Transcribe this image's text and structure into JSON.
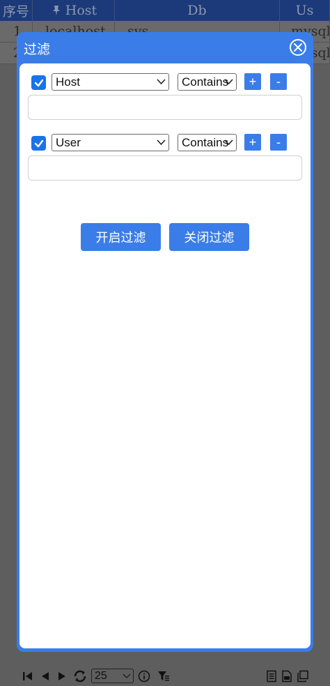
{
  "table": {
    "headers": [
      "序号",
      "Host",
      "Db",
      "Us"
    ],
    "rows": [
      [
        "1",
        "localhost",
        "sys",
        "mysql"
      ],
      [
        "2",
        "",
        "",
        "mysql"
      ]
    ]
  },
  "dialog": {
    "title": "过滤",
    "filters": [
      {
        "checked": true,
        "field": "Host",
        "operator": "Contains",
        "value": "",
        "add_label": "+",
        "remove_label": "-"
      },
      {
        "checked": true,
        "field": "User",
        "operator": "Contains",
        "value": "",
        "add_label": "+",
        "remove_label": "-"
      }
    ],
    "open_filter_label": "开启过滤",
    "close_filter_label": "关闭过滤"
  },
  "pager": {
    "page_size": "25",
    "icons": [
      "first-page-icon",
      "prev-page-icon",
      "next-page-icon",
      "refresh-icon",
      "info-icon",
      "filter-icon",
      "document-icon",
      "export-icon",
      "copy-icon"
    ]
  },
  "colors": {
    "accent": "#3a7de8",
    "checkbox": "#1a73e8",
    "overlay": "#5e5e5e",
    "header_bg": "#1c3a7a"
  }
}
